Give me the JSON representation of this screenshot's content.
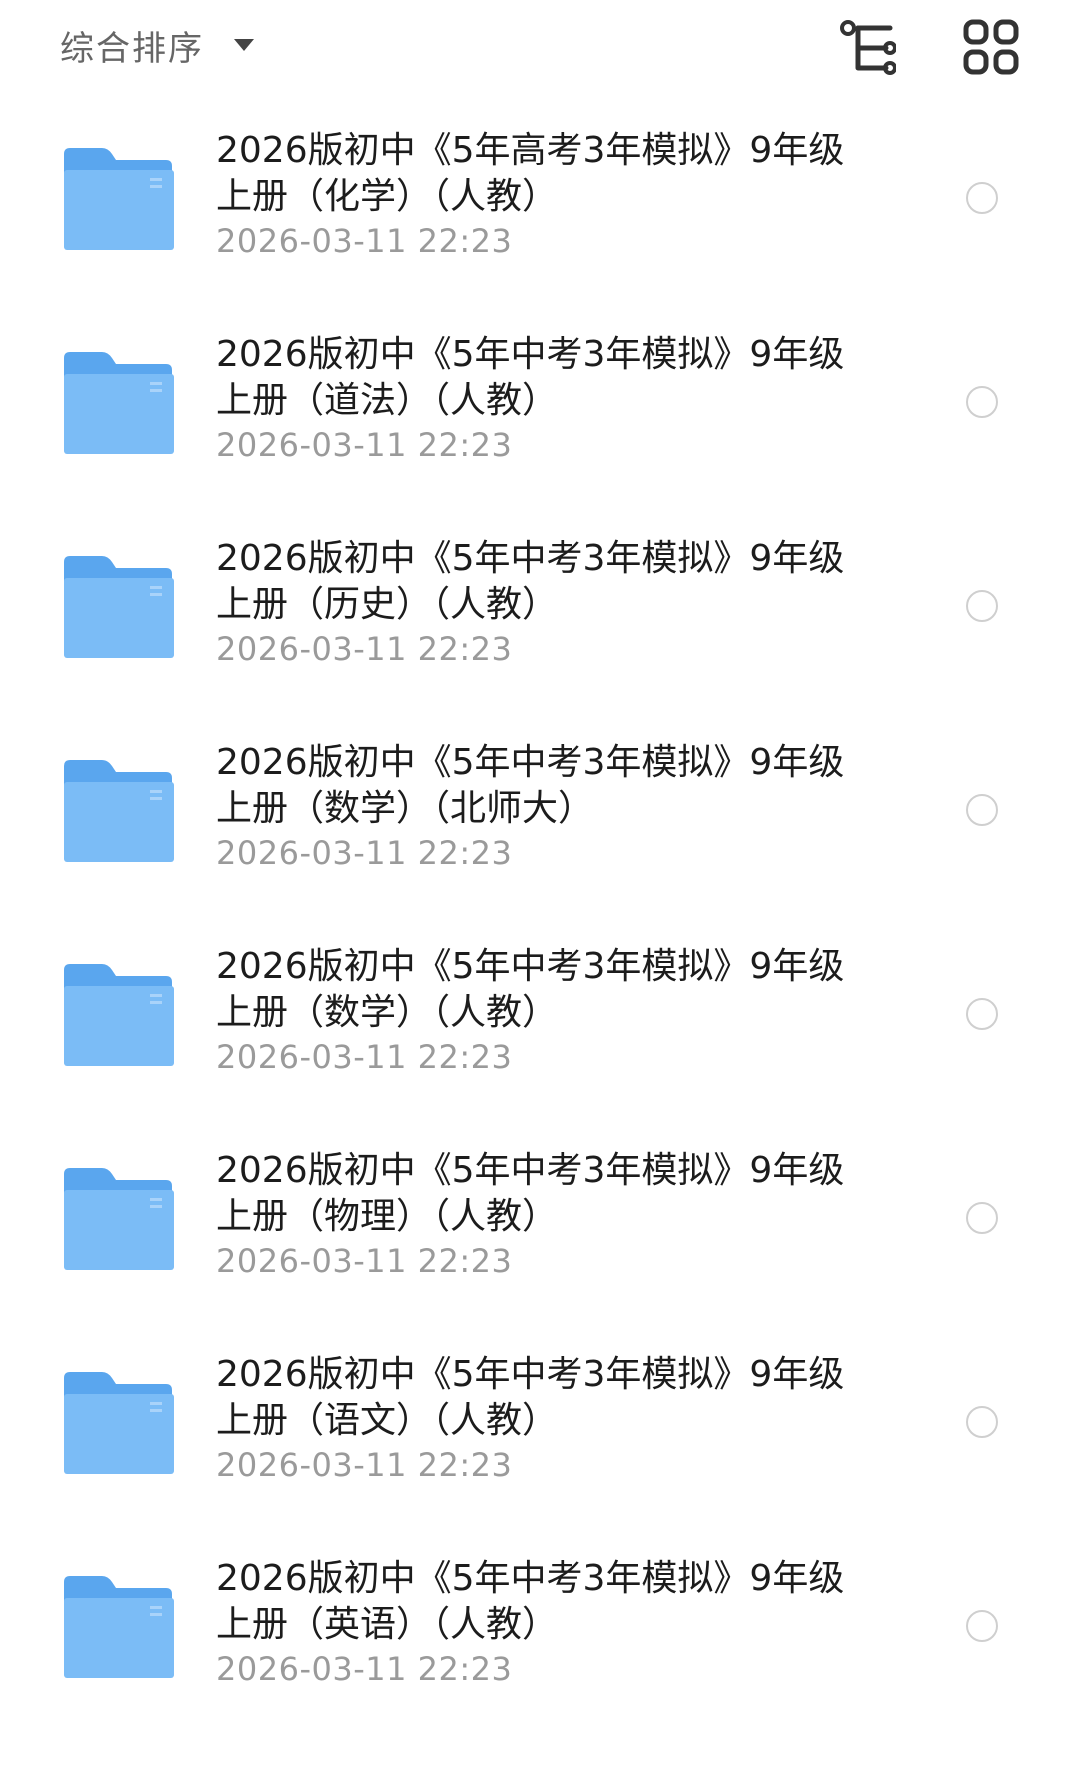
{
  "header": {
    "sort_label": "综合排序",
    "icons": [
      "chevron-down-icon",
      "tree-view-icon",
      "grid-view-icon"
    ]
  },
  "colors": {
    "folder_front": "#7bbcf6",
    "folder_back": "#5aa6ee",
    "radio_border": "#cfcfcf",
    "date_text": "#9a9a9a"
  },
  "files": [
    {
      "title": "2026版初中《5年高考3年模拟》9年级上册（化学）（人教）",
      "date": "2026-03-11 22:23",
      "icon": "folder-icon",
      "selected": false
    },
    {
      "title": "2026版初中《5年中考3年模拟》9年级上册（道法）（人教）",
      "date": "2026-03-11 22:23",
      "icon": "folder-icon",
      "selected": false
    },
    {
      "title": "2026版初中《5年中考3年模拟》9年级上册（历史）（人教）",
      "date": "2026-03-11 22:23",
      "icon": "folder-icon",
      "selected": false
    },
    {
      "title": "2026版初中《5年中考3年模拟》9年级上册（数学）（北师大）",
      "date": "2026-03-11 22:23",
      "icon": "folder-icon",
      "selected": false
    },
    {
      "title": "2026版初中《5年中考3年模拟》9年级上册（数学）（人教）",
      "date": "2026-03-11 22:23",
      "icon": "folder-icon",
      "selected": false
    },
    {
      "title": "2026版初中《5年中考3年模拟》9年级上册（物理）（人教）",
      "date": "2026-03-11 22:23",
      "icon": "folder-icon",
      "selected": false
    },
    {
      "title": "2026版初中《5年中考3年模拟》9年级上册（语文）（人教）",
      "date": "2026-03-11 22:23",
      "icon": "folder-icon",
      "selected": false
    },
    {
      "title": "2026版初中《5年中考3年模拟》9年级上册（英语）（人教）",
      "date": "2026-03-11 22:23",
      "icon": "folder-icon",
      "selected": false
    }
  ]
}
